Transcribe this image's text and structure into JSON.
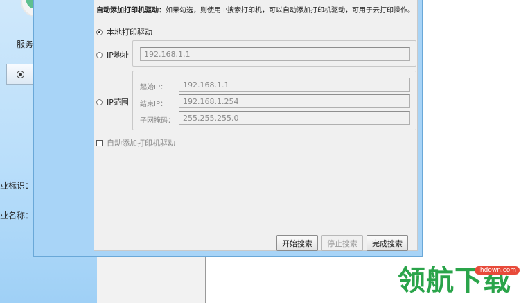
{
  "background_app": {
    "service_label": "服务",
    "field_label_id": "业标识：",
    "field_label_name": "业名称："
  },
  "dialog": {
    "hint_bold": "自动添加打印机驱动：",
    "hint_text": "如果勾选，则使用IP搜索打印机，可以自动添加打印机驱动，可用于云打印操作。",
    "radio_local": "本地打印驱动",
    "radio_ip": "IP地址",
    "ip_value": "192.168.1.1",
    "radio_range": "IP范围",
    "start_ip_label": "起始IP：",
    "start_ip_value": "192.168.1.1",
    "end_ip_label": "结束IP：",
    "end_ip_value": "192.168.1.254",
    "mask_label": "子网掩码：",
    "mask_value": "255.255.255.0",
    "auto_add_checkbox": "自动添加打印机驱动",
    "btn_start": "开始搜索",
    "btn_stop": "停止搜索",
    "btn_finish": "完成搜索"
  },
  "watermark": {
    "text": "领航下载",
    "domain": "lhdown.com"
  }
}
